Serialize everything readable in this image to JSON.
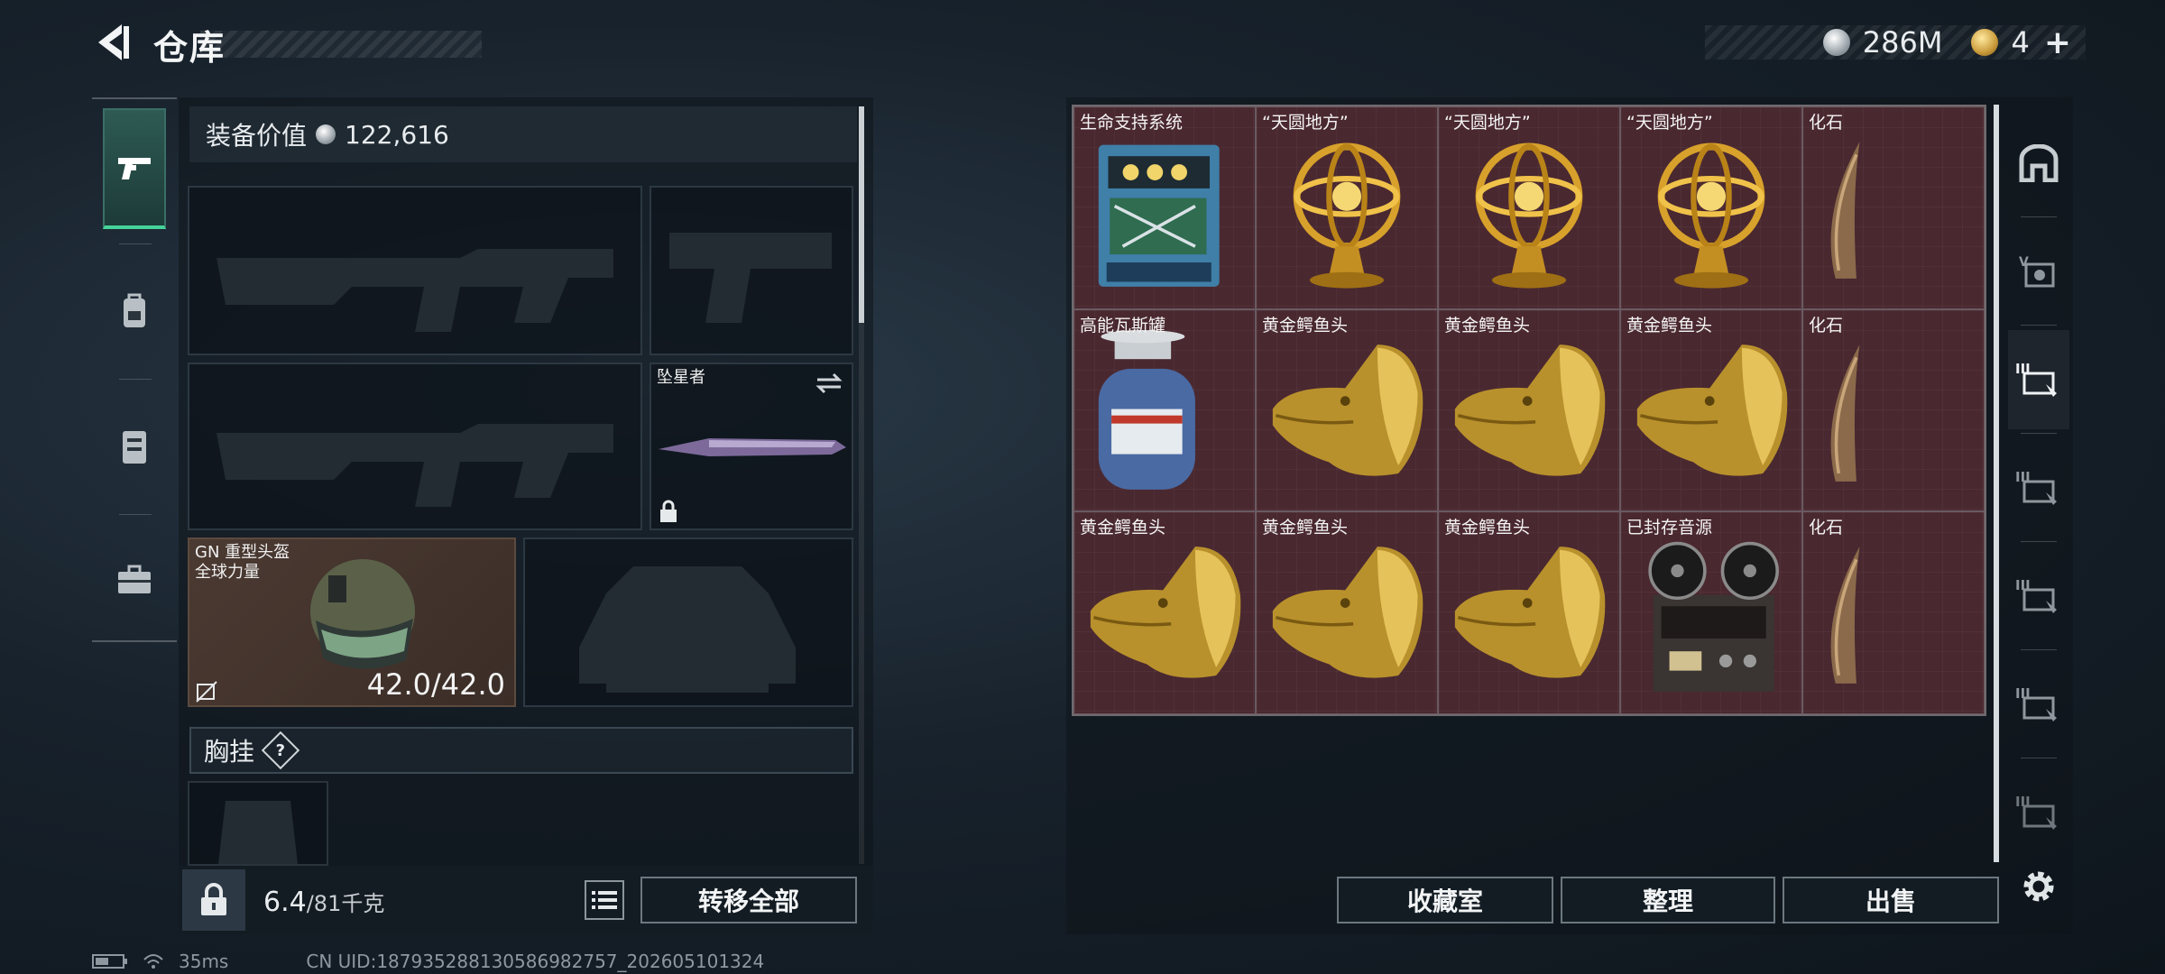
{
  "header": {
    "title": "仓库",
    "silver_amount": "286M",
    "gold_amount": "4"
  },
  "equipment": {
    "value_label": "装备价值",
    "value_amount": "122,616",
    "melee_slot_label": "坠星者",
    "helmet_name_line1": "GN 重型头盔",
    "helmet_name_line2": "全球力量",
    "helmet_durability": "42.0/42.0",
    "chest_rig_label": "胸挂",
    "chest_rig_help": "?",
    "weight_current": "6.4",
    "weight_max": "/81千克",
    "transfer_all_label": "转移全部"
  },
  "inventory": {
    "items": [
      {
        "label": "生命支持系统",
        "icon": "life-support-system"
      },
      {
        "label": "“天圆地方”",
        "icon": "gold-armillary-sphere"
      },
      {
        "label": "“天圆地方”",
        "icon": "gold-armillary-sphere"
      },
      {
        "label": "“天圆地方”",
        "icon": "gold-armillary-sphere"
      },
      {
        "label": "化石",
        "icon": "fossil-claw"
      },
      {
        "label": "高能瓦斯罐",
        "icon": "gas-canister"
      },
      {
        "label": "黄金鳄鱼头",
        "icon": "gold-crocodile-head"
      },
      {
        "label": "黄金鳄鱼头",
        "icon": "gold-crocodile-head"
      },
      {
        "label": "黄金鳄鱼头",
        "icon": "gold-crocodile-head"
      },
      {
        "label": "化石",
        "icon": "fossil-claw"
      },
      {
        "label": "黄金鳄鱼头",
        "icon": "gold-crocodile-head"
      },
      {
        "label": "黄金鳄鱼头",
        "icon": "gold-crocodile-head"
      },
      {
        "label": "黄金鳄鱼头",
        "icon": "gold-crocodile-head"
      },
      {
        "label": "已封存音源",
        "icon": "reel-tape-recorder"
      },
      {
        "label": "化石",
        "icon": "fossil-claw"
      }
    ],
    "collection_label": "收藏室",
    "sort_label": "整理",
    "sell_label": "出售"
  },
  "status": {
    "ping": "35ms",
    "uid": "CN UID:187935288130586982757_202605101324"
  },
  "colors": {
    "accent_green": "#46d39b",
    "inventory_cell": "#4a2830",
    "helmet_slot": "#4b3a32"
  }
}
